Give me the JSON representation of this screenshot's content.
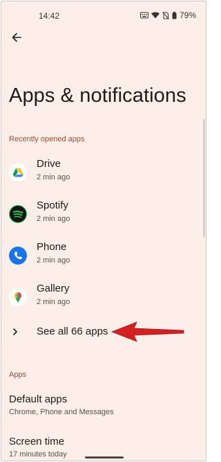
{
  "status_bar": {
    "time": "14:42",
    "battery": "79%",
    "icons": [
      "keyboard-icon",
      "wifi-icon",
      "no-sim-icon",
      "battery-icon"
    ]
  },
  "header": {
    "back_icon": "arrow-left-icon",
    "title": "Apps & notifications"
  },
  "recent": {
    "label": "Recently opened apps",
    "apps": [
      {
        "name": "Drive",
        "time": "2 min ago",
        "icon": "google-drive-icon"
      },
      {
        "name": "Spotify",
        "time": "2 min ago",
        "icon": "spotify-icon"
      },
      {
        "name": "Phone",
        "time": "2 min ago",
        "icon": "phone-icon"
      },
      {
        "name": "Gallery",
        "time": "2 min ago",
        "icon": "gallery-icon"
      }
    ],
    "see_all": "See all 66 apps"
  },
  "apps_section": {
    "label": "Apps",
    "items": [
      {
        "title": "Default apps",
        "subtitle": "Chrome, Phone and Messages"
      },
      {
        "title": "Screen time",
        "subtitle": "17 minutes today"
      }
    ]
  },
  "colors": {
    "background": "#fcefe9",
    "accent": "#9a4b32",
    "annotation_arrow": "#d61f1f"
  }
}
